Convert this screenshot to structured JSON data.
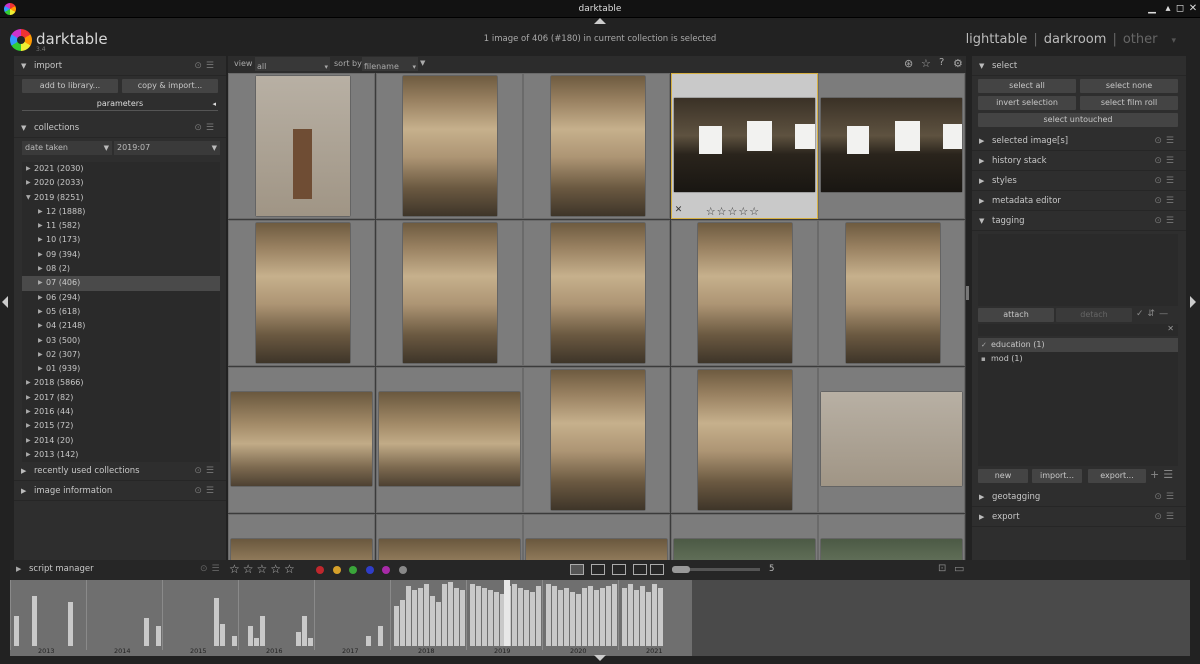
{
  "window": {
    "title": "darktable"
  },
  "header": {
    "brand": "darktable",
    "version": "3.4",
    "status": "1 image of 406 (#180) in current collection is selected",
    "views": [
      "lighttable",
      "darkroom",
      "other"
    ],
    "separator": "|"
  },
  "left": {
    "import": {
      "title": "import",
      "add_label": "add to library...",
      "copy_label": "copy & import...",
      "params_label": "parameters"
    },
    "collections": {
      "title": "collections",
      "property": "date taken",
      "filter": "2019:07",
      "rows": [
        {
          "label": "2021 (2030)",
          "level": 0,
          "open": false
        },
        {
          "label": "2020 (2033)",
          "level": 0,
          "open": false
        },
        {
          "label": "2019 (8251)",
          "level": 0,
          "open": true
        },
        {
          "label": "12 (1888)",
          "level": 1,
          "open": false
        },
        {
          "label": "11 (582)",
          "level": 1,
          "open": false
        },
        {
          "label": "10 (173)",
          "level": 1,
          "open": false
        },
        {
          "label": "09 (394)",
          "level": 1,
          "open": false
        },
        {
          "label": "08 (2)",
          "level": 1,
          "open": false
        },
        {
          "label": "07 (406)",
          "level": 1,
          "open": false,
          "selected": true
        },
        {
          "label": "06 (294)",
          "level": 1,
          "open": false
        },
        {
          "label": "05 (618)",
          "level": 1,
          "open": false
        },
        {
          "label": "04 (2148)",
          "level": 1,
          "open": false
        },
        {
          "label": "03 (500)",
          "level": 1,
          "open": false
        },
        {
          "label": "02 (307)",
          "level": 1,
          "open": false
        },
        {
          "label": "01 (939)",
          "level": 1,
          "open": false
        },
        {
          "label": "2018 (5866)",
          "level": 0,
          "open": false
        },
        {
          "label": "2017 (82)",
          "level": 0,
          "open": false
        },
        {
          "label": "2016 (44)",
          "level": 0,
          "open": false
        },
        {
          "label": "2015 (72)",
          "level": 0,
          "open": false
        },
        {
          "label": "2014 (20)",
          "level": 0,
          "open": false
        },
        {
          "label": "2013 (142)",
          "level": 0,
          "open": false
        }
      ]
    },
    "recent": {
      "title": "recently used collections"
    },
    "image_info": {
      "title": "image information"
    }
  },
  "toolbar": {
    "view_label": "view",
    "view_value": "all",
    "sort_label": "sort by",
    "sort_value": "filename",
    "help": "?"
  },
  "thumbs": [
    {
      "kind": "statue"
    },
    {
      "kind": "portrait"
    },
    {
      "kind": "portrait"
    },
    {
      "kind": "dark",
      "selected": true,
      "rating": "☆☆☆☆☆",
      "reject": "✕"
    },
    {
      "kind": "dark"
    },
    {
      "kind": "portrait"
    },
    {
      "kind": "portrait"
    },
    {
      "kind": "portrait"
    },
    {
      "kind": "portrait"
    },
    {
      "kind": "portrait"
    },
    {
      "kind": "land"
    },
    {
      "kind": "land"
    },
    {
      "kind": "portrait"
    },
    {
      "kind": "portrait"
    },
    {
      "kind": "stone"
    },
    {
      "kind": "land"
    },
    {
      "kind": "land"
    },
    {
      "kind": "land"
    },
    {
      "kind": "green"
    },
    {
      "kind": "green"
    }
  ],
  "right": {
    "select": {
      "title": "select",
      "buttons": [
        "select all",
        "select none",
        "invert selection",
        "select film roll",
        "select untouched"
      ]
    },
    "modules": [
      "selected image[s]",
      "history stack",
      "styles",
      "metadata editor"
    ],
    "tagging": {
      "title": "tagging",
      "attach": "attach",
      "detach": "detach",
      "tags": [
        {
          "label": "education (1)",
          "on": true
        },
        {
          "label": "mod (1)",
          "on": false
        }
      ],
      "new": "new",
      "import": "import...",
      "export": "export..."
    },
    "geotagging": {
      "title": "geotagging"
    },
    "export": {
      "title": "export"
    }
  },
  "bottom": {
    "script_manager": "script manager",
    "rating": "☆☆☆☆☆",
    "color_labels": [
      "#c0272d",
      "#d6a02a",
      "#3aa53a",
      "#2f3dc8",
      "#a82aa8",
      "#888888"
    ],
    "zoom": "5"
  },
  "timeline": {
    "years": [
      "2013",
      "2014",
      "2015",
      "2016",
      "2017",
      "2018",
      "2019",
      "2020",
      "2021"
    ]
  }
}
